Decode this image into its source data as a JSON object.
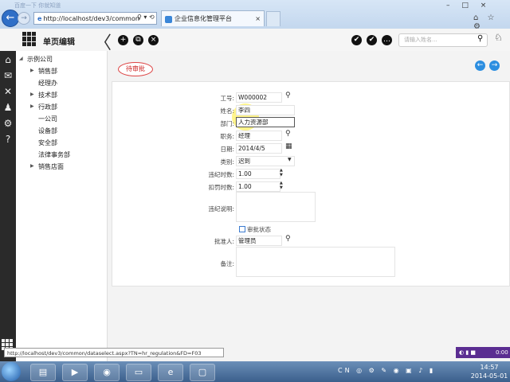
{
  "browser": {
    "blurred_title": "百度一下 你就知道",
    "address": "http://localhost/dev3/common",
    "address_tools": "♀ ▾ ⟲",
    "tab_title": "企业信息化管理平台",
    "tab_close": "×",
    "window_controls": "– □ ×",
    "nav_back": "←",
    "nav_forward": "→",
    "toolbar_icons": "⌂ ☆ ⚙"
  },
  "app": {
    "title": "单页编辑",
    "collapse_glyph": "〈",
    "add_glyph": "+",
    "copy_glyph": "⧉",
    "delete_glyph": "×",
    "approve_glyph": "✔",
    "approve_all_glyph": "✔",
    "more_glyph": "…",
    "search_placeholder": "请输入姓名...",
    "search_glyph": "⚲",
    "user_glyph": "♘"
  },
  "sidebar_icons": [
    {
      "name": "home-icon",
      "glyph": "⌂"
    },
    {
      "name": "chat-icon",
      "glyph": "✉"
    },
    {
      "name": "tools-icon",
      "glyph": "✕"
    },
    {
      "name": "person-icon",
      "glyph": "♟"
    },
    {
      "name": "settings-icon",
      "glyph": "⚙"
    },
    {
      "name": "help-icon",
      "glyph": "?"
    }
  ],
  "tree": [
    {
      "label": "示例公司",
      "expanded": true
    },
    {
      "label": "销售部",
      "collapsed": true
    },
    {
      "label": "经理办"
    },
    {
      "label": "技术部",
      "collapsed": true
    },
    {
      "label": "行政部",
      "collapsed": true
    },
    {
      "label": "一公司"
    },
    {
      "label": "设备部"
    },
    {
      "label": "安全部"
    },
    {
      "label": "法律事务部"
    },
    {
      "label": "销售店面",
      "collapsed": true
    }
  ],
  "status_tag": "待审批",
  "nav": {
    "prev": "←",
    "next": "→"
  },
  "form": {
    "emp_no": {
      "label": "工号:",
      "value": "W000002"
    },
    "name": {
      "label": "姓名:",
      "value": "李四"
    },
    "dept": {
      "label": "部门:",
      "value": "人力资源部"
    },
    "position": {
      "label": "职务:",
      "value": "经理"
    },
    "date": {
      "label": "日期:",
      "value": "2014/4/5"
    },
    "type": {
      "label": "类别:",
      "value": "迟到"
    },
    "violation_hours": {
      "label": "违纪时数:",
      "value": "1.00"
    },
    "deduct_hours": {
      "label": "扣罚时数:",
      "value": "1.00"
    },
    "violation_desc": {
      "label": "违纪说明:",
      "value": ""
    },
    "approval_status_label": "审批状态",
    "approver": {
      "label": "批准人:",
      "value": "管理员"
    },
    "remark": {
      "label": "备注:",
      "value": ""
    }
  },
  "statusbar": {
    "url": "http://localhost/dev3/common/dataselect.aspx?TN=hr_regulation&FD=F03",
    "recorder_time": "0:00"
  },
  "taskbar": {
    "apps": [
      {
        "name": "explorer-taskbar-icon",
        "glyph": "▤"
      },
      {
        "name": "media-player-taskbar-icon",
        "glyph": "▶"
      },
      {
        "name": "chrome-taskbar-icon",
        "glyph": "◉"
      },
      {
        "name": "folder-taskbar-icon",
        "glyph": "▭"
      },
      {
        "name": "ie-taskbar-icon",
        "glyph": "e"
      },
      {
        "name": "window-taskbar-icon",
        "glyph": "▢"
      }
    ],
    "tray_lang": "CN",
    "time": "14:57",
    "date": "2014-05-01"
  }
}
